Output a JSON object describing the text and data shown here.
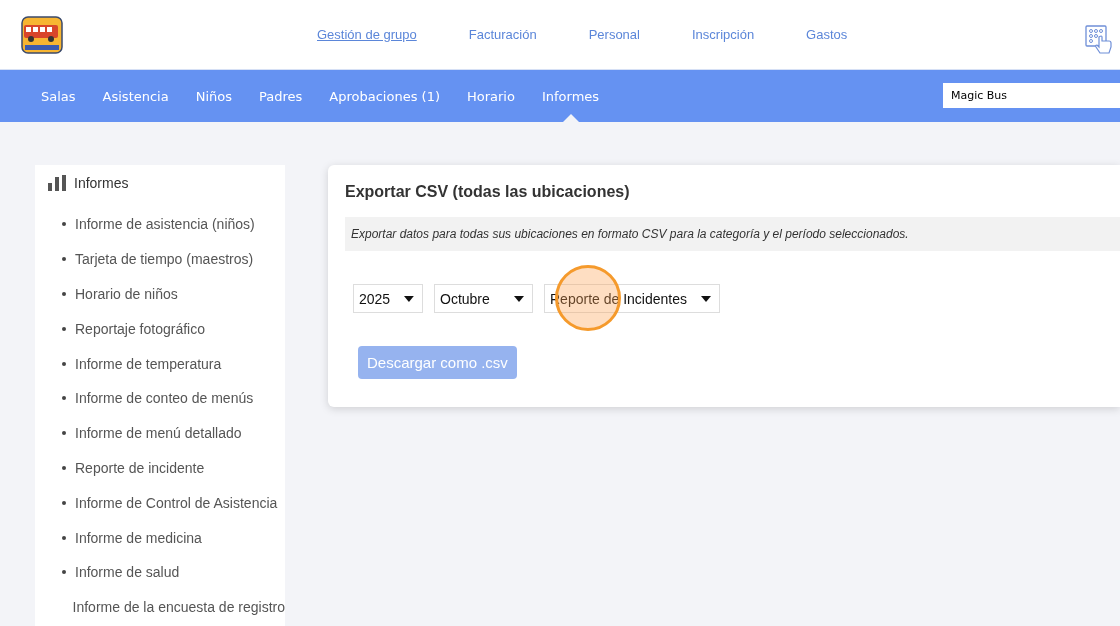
{
  "top_links": [
    {
      "label": "Gestión de grupo",
      "selected": true
    },
    {
      "label": "Facturación",
      "selected": false
    },
    {
      "label": "Personal",
      "selected": false
    },
    {
      "label": "Inscripción",
      "selected": false
    },
    {
      "label": "Gastos",
      "selected": false
    }
  ],
  "nav": [
    {
      "label": "Salas",
      "selected": false
    },
    {
      "label": "Asistencia",
      "selected": false
    },
    {
      "label": "Niños",
      "selected": false
    },
    {
      "label": "Padres",
      "selected": false
    },
    {
      "label": "Aprobaciones (1)",
      "selected": false
    },
    {
      "label": "Horario",
      "selected": false
    },
    {
      "label": "Informes",
      "selected": true
    }
  ],
  "location_field": {
    "value": "Magic Bus"
  },
  "sidebar": {
    "title": "Informes",
    "items": [
      {
        "label": "Informe de asistencia (niños)",
        "bullet": true
      },
      {
        "label": "Tarjeta de tiempo (maestros)",
        "bullet": true
      },
      {
        "label": "Horario de niños",
        "bullet": true
      },
      {
        "label": "Reportaje fotográfico",
        "bullet": true
      },
      {
        "label": "Informe de temperatura",
        "bullet": true
      },
      {
        "label": "Informe de conteo de menús",
        "bullet": true
      },
      {
        "label": "Informe de menú detallado",
        "bullet": true
      },
      {
        "label": "Reporte de incidente",
        "bullet": true
      },
      {
        "label": "Informe de Control de Asistencia",
        "bullet": true
      },
      {
        "label": "Informe de medicina",
        "bullet": true
      },
      {
        "label": "Informe de salud",
        "bullet": true
      },
      {
        "label": "Informe de la encuesta de registro",
        "bullet": false
      }
    ]
  },
  "export_card": {
    "title": "Exportar CSV (todas las ubicaciones)",
    "description": "Exportar datos para todas sus ubicaciones en formato CSV para la categoría y el período seleccionados.",
    "selects": [
      {
        "value": "2025"
      },
      {
        "value": "Octubre"
      },
      {
        "value": "Reporte de Incidentes",
        "click_marker": true
      }
    ],
    "button": {
      "label": "Descargar como .csv",
      "disabled": true
    }
  }
}
